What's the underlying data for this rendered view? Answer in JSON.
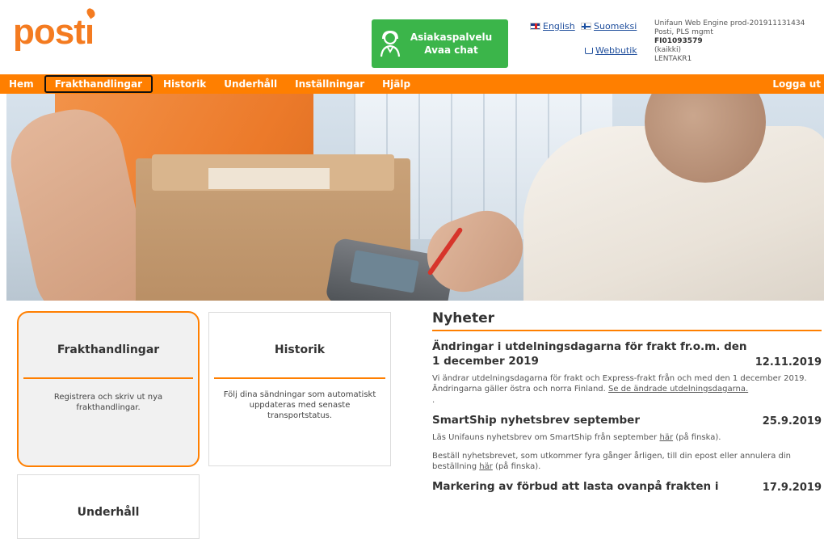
{
  "logo": {
    "text_before_i": "post",
    "text_i": "ı"
  },
  "chat": {
    "line1": "Asiakaspalvelu",
    "line2": "Avaa chat"
  },
  "languages": [
    {
      "label": "English"
    },
    {
      "label": "Suomeksi"
    }
  ],
  "webbutik": "Webbutik",
  "sysinfo": {
    "line1": "Unifaun Web Engine prod-201911131434",
    "line2": "Posti, PLS mgmt",
    "line3": "FI01093579",
    "line4": "(kaikki)",
    "line5": "LENTAKR1"
  },
  "nav": {
    "items": [
      "Hem",
      "Frakthandlingar",
      "Historik",
      "Underhåll",
      "Inställningar",
      "Hjälp"
    ],
    "logout": "Logga ut"
  },
  "cards": [
    {
      "title": "Frakthandlingar",
      "desc": "Registrera och skriv ut nya frakthandlingar."
    },
    {
      "title": "Historik",
      "desc": "Följ dina sändningar som automatiskt uppdateras med senaste transportstatus."
    },
    {
      "title": "Underhåll",
      "desc": ""
    }
  ],
  "news": {
    "title": "Nyheter",
    "items": [
      {
        "heading": "Ändringar i utdelningsdagarna för frakt fr.o.m. den 1 december 2019",
        "date": "12.11.2019",
        "body_before": "Vi ändrar utdelningsdagarna för frakt och Express-frakt från och med den 1 december 2019. Ändringarna gäller östra och norra Finland. ",
        "link": "Se de ändrade utdelningsdagarna.",
        "body_after": "",
        "extra": "."
      },
      {
        "heading": "SmartShip nyhetsbrev september",
        "date": "25.9.2019",
        "body_before": "Läs Unifauns nyhetsbrev om SmartShip från september ",
        "link": "här",
        "body_after": " (på finska).",
        "para2_before": "Beställ nyhetsbrevet, som utkommer fyra gånger årligen, till din epost eller annulera din beställning ",
        "para2_link": "här",
        "para2_after": " (på finska)."
      },
      {
        "heading": "Markering av förbud att lasta ovanpå frakten i",
        "date": "17.9.2019"
      }
    ]
  }
}
